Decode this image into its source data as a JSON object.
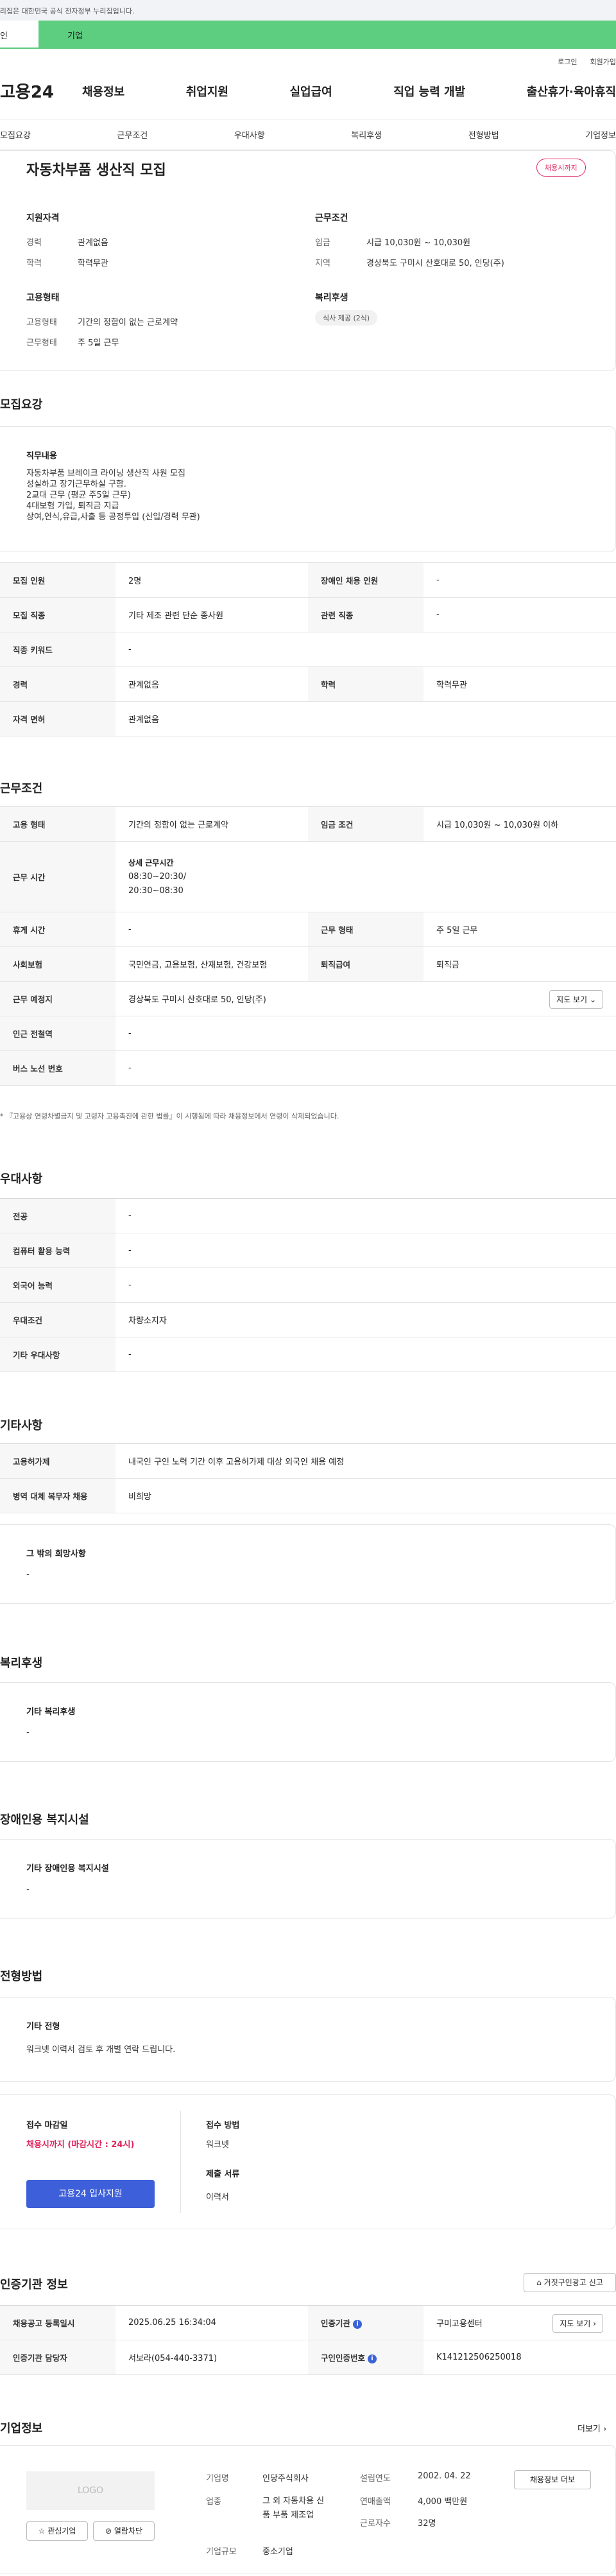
{
  "gov_banner": "이 누리집은 대한민국 공식 전자정부 누리집입니다.",
  "audience": {
    "personal": "개인",
    "company": "기업"
  },
  "util": {
    "login": "로그인",
    "signup": "회원가입"
  },
  "logo": "고용24",
  "gnb": [
    "채용정보",
    "취업지원",
    "실업급여",
    "직업 능력 개발",
    "출산휴가·육아휴직"
  ],
  "subtabs": [
    "모집요강",
    "근무조건",
    "우대사항",
    "복리후생",
    "전형방법",
    "기업정보"
  ],
  "summary": {
    "title": "자동차부품 생산직 모집",
    "badge": "채용시까지",
    "qual_title": "지원자격",
    "qual": [
      {
        "k": "경력",
        "v": "관계없음"
      },
      {
        "k": "학력",
        "v": "학력무관"
      }
    ],
    "cond_title": "근무조건",
    "cond": [
      {
        "k": "임금",
        "v": "시급 10,030원 ~ 10,030원"
      },
      {
        "k": "지역",
        "v": "경상북도 구미시 산호대로 50, 인당(주)"
      }
    ],
    "emp_title": "고용형태",
    "emp": [
      {
        "k": "고용형태",
        "v": "기간의 정함이 없는 근로계약"
      },
      {
        "k": "근무형태",
        "v": "주 5일 근무"
      }
    ],
    "welfare_title": "복리후생",
    "welfare_tag": "식사 제공 (2식)"
  },
  "recruit": {
    "section": "모집요강",
    "job_title": "직무내용",
    "job_lines": [
      "자동차부품 브레이크 라이닝 생산직 사원 모집",
      "성실하고 장기근무하실 구함.",
      "2교대 근무 (평균 주5일 근무)",
      "4대보험 가입, 퇴직금 지급",
      "상여,연식,유급,사출 등 공정투입 (신입/경력 무관)"
    ],
    "rows": [
      [
        "모집 인원",
        "2명",
        "장애인 채용 인원",
        "-"
      ],
      [
        "모집 직종",
        "기타 제조 관련 단순 종사원",
        "관련 직종",
        "-"
      ],
      [
        "직종 키워드",
        "-"
      ],
      [
        "경력",
        "관계없음",
        "학력",
        "학력무관"
      ],
      [
        "자격 면허",
        "관계없음"
      ]
    ]
  },
  "work": {
    "section": "근무조건",
    "type_k": "고용 형태",
    "type_v": "기간의 정함이 없는 근로계약",
    "wage_k": "임금 조건",
    "wage_v": "시급 10,030원 ~ 10,030원 이하",
    "hours_k": "근무 시간",
    "hours_sub": "상세 근무시간",
    "hours_1": "08:30~20:30/",
    "hours_2": "20:30~08:30",
    "rest_k": "휴게 시간",
    "rest_v": "-",
    "form_k": "근무 형태",
    "form_v": "주 5일 근무",
    "ins_k": "사회보험",
    "ins_v": "국민연금, 고용보험, 산재보험, 건강보험",
    "ret_k": "퇴직급여",
    "ret_v": "퇴직금",
    "place_k": "근무 예정지",
    "place_v": "경상북도 구미시 산호대로 50, 인당(주)",
    "map_btn": "지도 보기",
    "subway_k": "인근 전철역",
    "subway_v": "-",
    "bus_k": "버스 노선 번호",
    "bus_v": "-",
    "note": "『고용상 연령차별금지 및 고령자 고용촉진에 관한 법률』이 시행됨에 따라 채용정보에서 연령이 삭제되었습니다."
  },
  "prefer": {
    "section": "우대사항",
    "rows": [
      [
        "전공",
        "-"
      ],
      [
        "컴퓨터 활용 능력",
        "-"
      ],
      [
        "외국어 능력",
        "-"
      ],
      [
        "우대조건",
        "차량소지자"
      ],
      [
        "기타 우대사항",
        "-"
      ]
    ]
  },
  "etc": {
    "section": "기타사항",
    "rows": [
      [
        "고용허가제",
        "내국인 구인 노력 기간 이후 고용허가제 대상 외국인 채용 예정"
      ],
      [
        "병역 대체 복무자 채용",
        "비희망"
      ]
    ],
    "box_title": "그 밖의 희망사항",
    "box_val": "-"
  },
  "welfare": {
    "section": "복리후생",
    "box_title": "기타 복리후생",
    "box_val": "-"
  },
  "disability": {
    "section": "장애인용 복지시설",
    "box_title": "기타 장애인용 복지시설",
    "box_val": "-"
  },
  "screening": {
    "section": "전형방법",
    "box_title": "기타 전형",
    "box_val": "워크넷 이력서 검토 후 개별 연락 드립니다.",
    "deadline_k": "접수 마감일",
    "deadline_v": "채용시까지 (마감시간 : 24시)",
    "apply_btn": "고용24 입사지원",
    "method_k": "접수 방법",
    "method_v": "워크넷",
    "docs_k": "제출 서류",
    "docs_v": "이력서"
  },
  "agency": {
    "section": "인증기관 정보",
    "report_btn": "거짓구인광고 신고",
    "reg_k": "채용공고 등록일시",
    "reg_v": "2025.06.25 16:34:04",
    "org_k": "인증기관",
    "org_v": "구미고용센터",
    "map_btn": "지도 보기",
    "mgr_k": "인증기관 담당자",
    "mgr_v": "서보라(054-440-3371)",
    "no_k": "구인인증번호",
    "no_v": "K141212506250018"
  },
  "company": {
    "section": "기업정보",
    "more": "더보기",
    "logo": "LOGO",
    "fav": "관심기업",
    "block": "열람차단",
    "name_k": "기업명",
    "name_v": "인당주식회사",
    "ind_k": "업종",
    "ind_v1": "그 외 자동차용 신",
    "ind_v2": "품 부품 제조업",
    "size_k": "기업규모",
    "size_v": "중소기업",
    "year_k": "설립연도",
    "year_v": "2002. 04. 22",
    "sales_k": "연매출액",
    "sales_v": "4,000 백만원",
    "emp_k": "근로자수",
    "emp_v": "32명",
    "jobs_btn": "채용정보 더보"
  }
}
